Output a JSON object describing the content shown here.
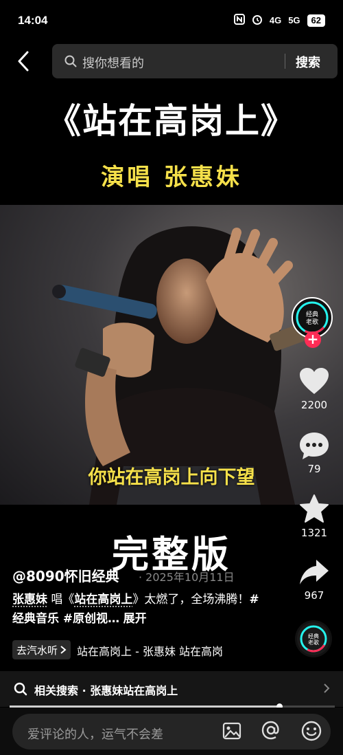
{
  "status_bar": {
    "time": "14:04",
    "network_1": "4G",
    "network_2": "5G",
    "battery": "62"
  },
  "search": {
    "placeholder": "搜你想看的",
    "button": "搜索"
  },
  "video": {
    "title": "《站在高岗上》",
    "subtitle": "演唱 张惠妹",
    "lyric": "你站在高岗上向下望",
    "overlay_label": "完整版"
  },
  "actions": {
    "avatar_text": "经典老歌",
    "likes": "2200",
    "comments": "79",
    "favorites": "1321",
    "shares": "967"
  },
  "post": {
    "author": "@8090怀旧经典",
    "date": "· 2025年10月11日",
    "caption_singer": "张惠妹",
    "caption_verb": " 唱《",
    "caption_song": "站在高岗上",
    "caption_rest": "》太燃了，全场沸腾！",
    "caption_tags": "#经典音乐 #原创视…",
    "expand": "展开"
  },
  "music": {
    "qishui_label": "去汽水听",
    "title": "站在高岗上 - 张惠妹 站在高岗"
  },
  "related": {
    "text": "相关搜索 · 张惠妹站在高岗上"
  },
  "playback": {
    "progress": 0.83
  },
  "comment_bar": {
    "placeholder": "爱评论的人，运气不会差"
  },
  "colors": {
    "lyric": "#f5e04a",
    "follow": "#fe2c55"
  }
}
